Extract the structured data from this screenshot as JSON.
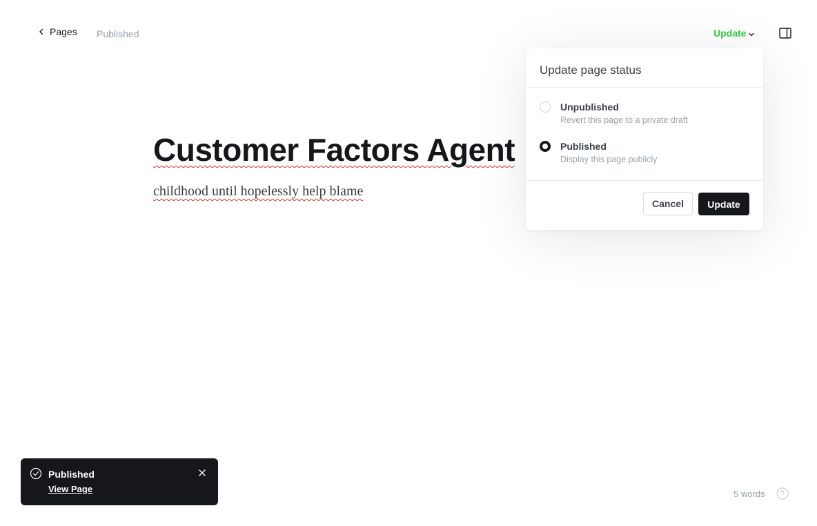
{
  "header": {
    "back_label": "Pages",
    "status": "Published",
    "update_label": "Update",
    "accent": "#30cf43"
  },
  "editor": {
    "title": "Customer Factors Agent",
    "body": "childhood until hopelessly help blame"
  },
  "popover": {
    "heading": "Update page status",
    "options": [
      {
        "label": "Unpublished",
        "description": "Revert this page to a private draft",
        "selected": false
      },
      {
        "label": "Published",
        "description": "Display this page publicly",
        "selected": true
      }
    ],
    "cancel_label": "Cancel",
    "confirm_label": "Update"
  },
  "toast": {
    "title": "Published",
    "link": "View Page"
  },
  "footer": {
    "word_count": "5 words"
  }
}
